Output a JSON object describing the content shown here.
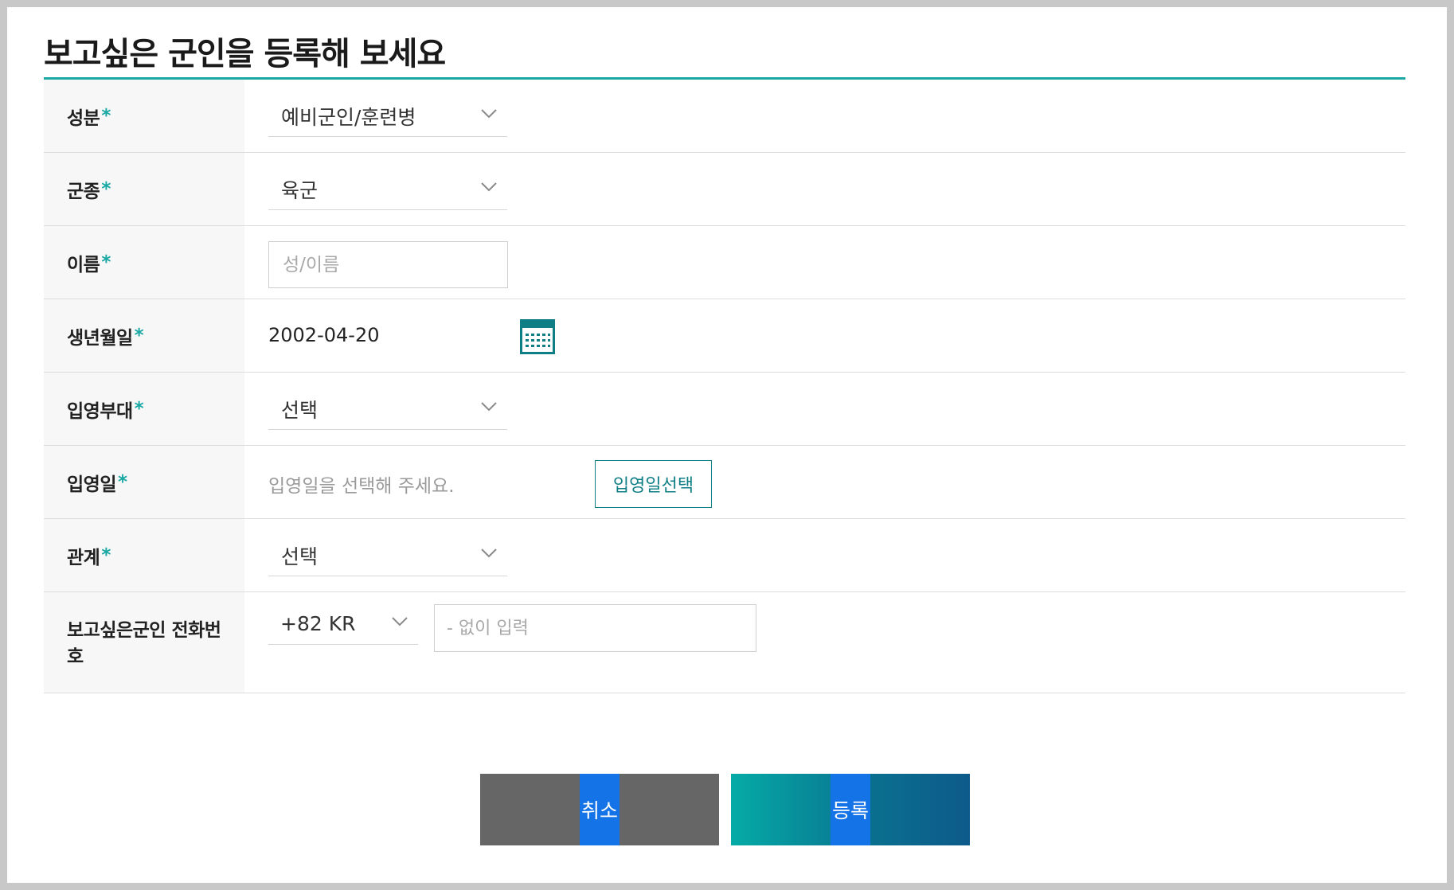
{
  "page": {
    "title": "보고싶은 군인을 등록해 보세요"
  },
  "form": {
    "required_mark": "*",
    "rows": [
      {
        "label": "성분",
        "value": "예비군인/훈련병"
      },
      {
        "label": "군종",
        "value": "육군"
      },
      {
        "label": "이름",
        "placeholder": "성/이름",
        "value": ""
      },
      {
        "label": "생년월일",
        "value": "2002-04-20",
        "icon": "calendar-icon"
      },
      {
        "label": "입영부대",
        "value": "선택"
      },
      {
        "label": "입영일",
        "placeholder": "입영일을 선택해 주세요.",
        "button_label": "입영일선택"
      },
      {
        "label": "관계",
        "value": "선택"
      },
      {
        "label": "보고싶은군인 전화번호",
        "country_code": "+82 KR",
        "placeholder": "- 없이 입력",
        "value": ""
      }
    ]
  },
  "actions": {
    "cancel_label": "취소",
    "submit_label": "등록"
  },
  "colors": {
    "accent": "#1aa8a5",
    "accent_dark": "#0f7e85",
    "cancel_bg": "#666666",
    "label_highlight": "#1473e6"
  }
}
